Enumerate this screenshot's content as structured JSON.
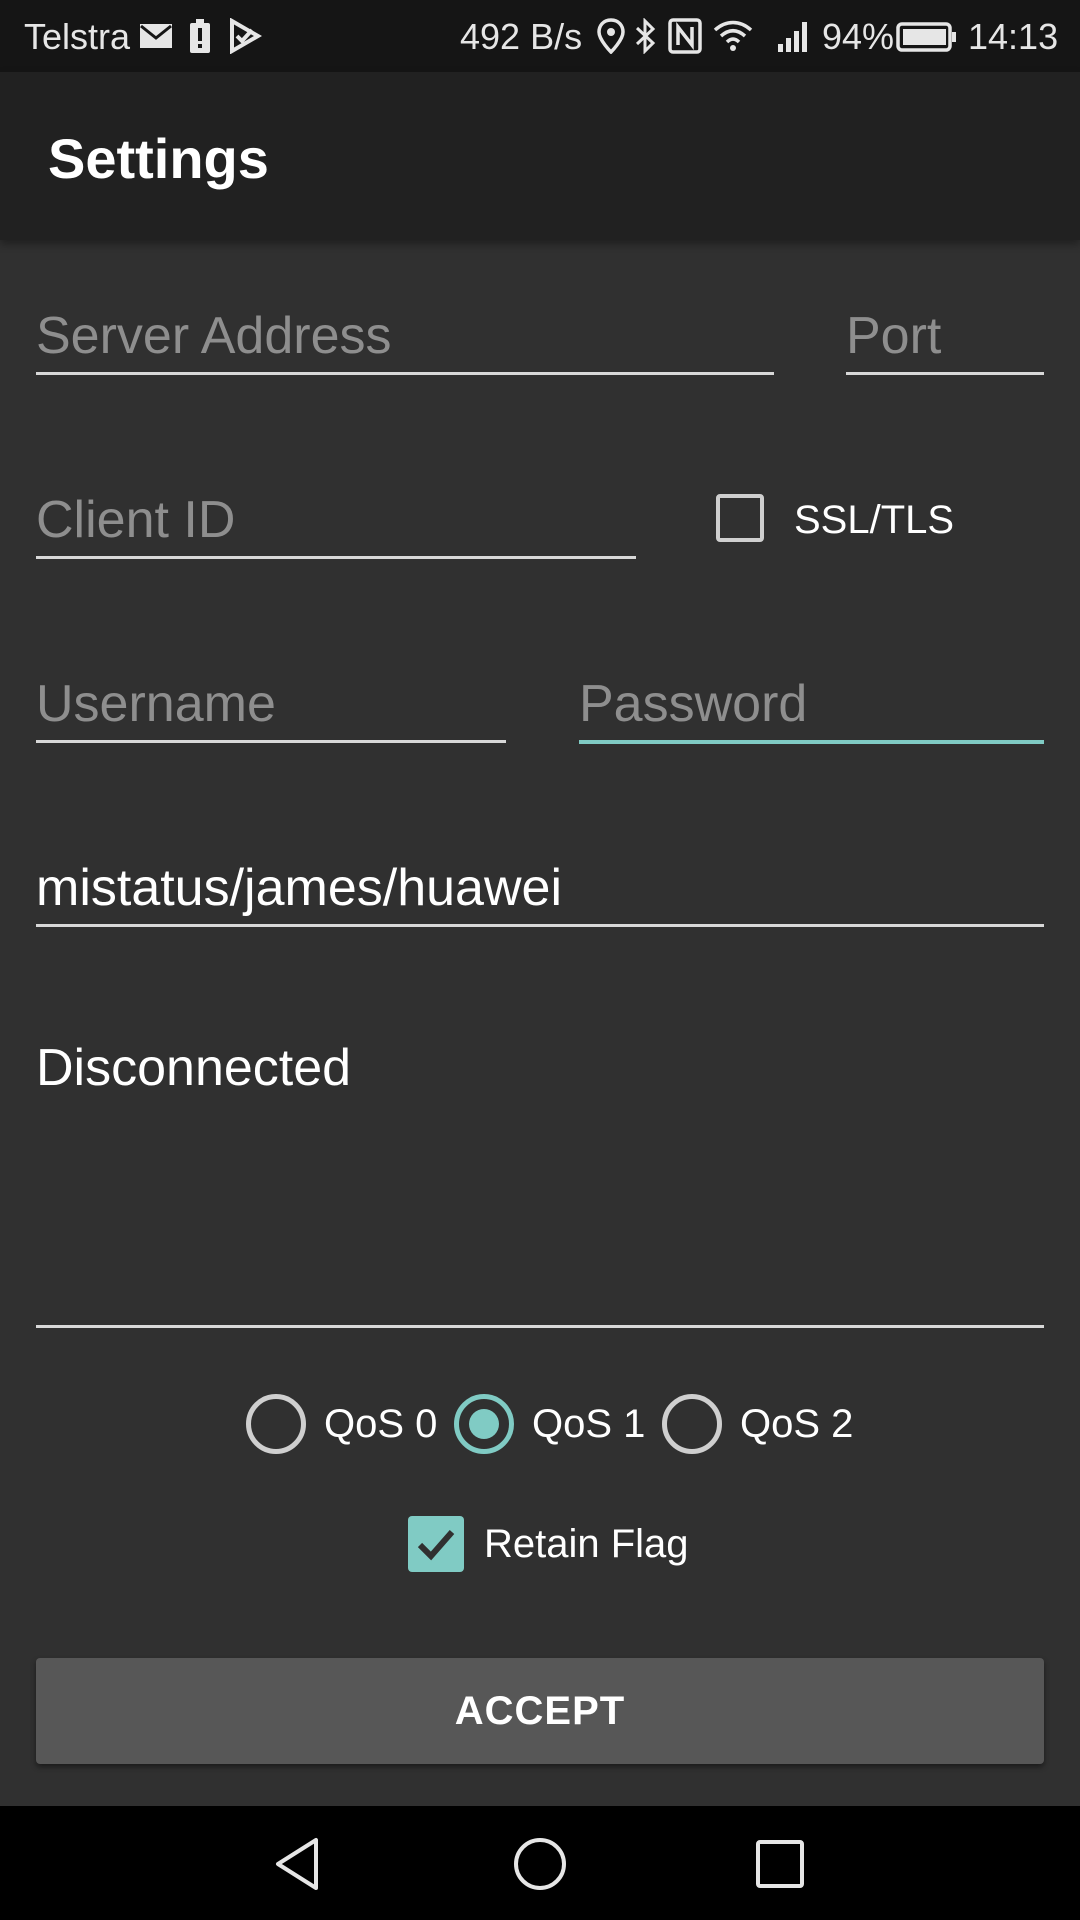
{
  "status_bar": {
    "carrier": "Telstra",
    "network_speed": "492 B/s",
    "battery": "94%",
    "time": "14:13",
    "icons": [
      "mail-icon",
      "battery-alert-icon",
      "play-protect-icon",
      "location-icon",
      "bluetooth-icon",
      "nfc-icon",
      "wifi-icon",
      "signal-icon",
      "battery-icon"
    ]
  },
  "app_bar": {
    "title": "Settings"
  },
  "form": {
    "server_address": {
      "placeholder": "Server Address",
      "value": ""
    },
    "port": {
      "placeholder": "Port",
      "value": ""
    },
    "client_id": {
      "placeholder": "Client ID",
      "value": ""
    },
    "ssl_tls": {
      "label": "SSL/TLS",
      "checked": false
    },
    "username": {
      "placeholder": "Username",
      "value": ""
    },
    "password": {
      "placeholder": "Password",
      "value": ""
    },
    "topic": {
      "value": "mistatus/james/huawei"
    },
    "status_text": "Disconnected",
    "qos": {
      "options": [
        "QoS 0",
        "QoS 1",
        "QoS 2"
      ],
      "selected": "QoS 1"
    },
    "retain_flag": {
      "label": "Retain Flag",
      "checked": true
    },
    "accept_label": "ACCEPT"
  },
  "colors": {
    "accent": "#80cbc4",
    "background": "#303030",
    "app_bar": "#212121",
    "button": "#575757"
  },
  "nav_bar": {
    "icons": [
      "back-icon",
      "home-icon",
      "recents-icon"
    ]
  }
}
